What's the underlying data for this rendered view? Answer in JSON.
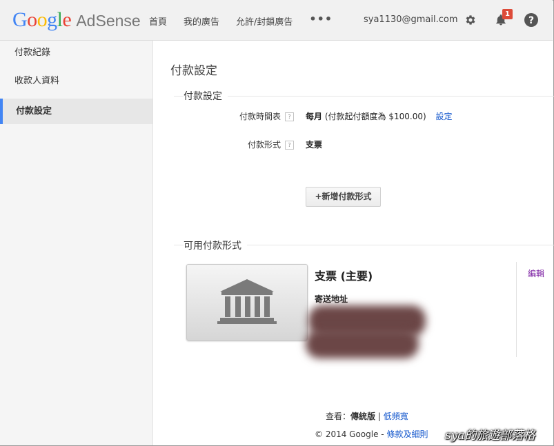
{
  "header": {
    "logo_google": "Google",
    "logo_product": "AdSense",
    "nav": [
      "首頁",
      "我的廣告",
      "允許/封鎖廣告"
    ],
    "more": "•••",
    "email": "sya1130@gmail.com",
    "notification_count": "1"
  },
  "sidebar": {
    "items": [
      {
        "label": "付款紀錄"
      },
      {
        "label": "收款人資料"
      },
      {
        "label": "付款設定"
      }
    ],
    "active_index": 2
  },
  "main": {
    "page_title": "付款設定",
    "settings_section": {
      "heading": "付款設定",
      "schedule_label": "付款時間表",
      "schedule_value_bold": "每月",
      "schedule_value_rest": "(付款起付額度為 $100.00)",
      "schedule_link": "設定",
      "form_label": "付款形式",
      "form_value": "支票",
      "help_mark": "?",
      "add_button": "+新增付款形式"
    },
    "available_section": {
      "heading": "可用付款形式",
      "method_title": "支票 (主要)",
      "address_label": "寄送地址",
      "edit_link": "編輯"
    }
  },
  "footer": {
    "view_label": "查看：",
    "view_classic": "傳統版",
    "view_separator": "|",
    "view_low": "低頻寬",
    "copyright": "© 2014 Google -",
    "terms": "條款及細則"
  },
  "watermark": "sya的旅遊部落格",
  "colors": {
    "accent": "#4285f4",
    "link": "#1155cc",
    "edit_link": "#7b1fa2",
    "badge": "#dd4b39"
  }
}
